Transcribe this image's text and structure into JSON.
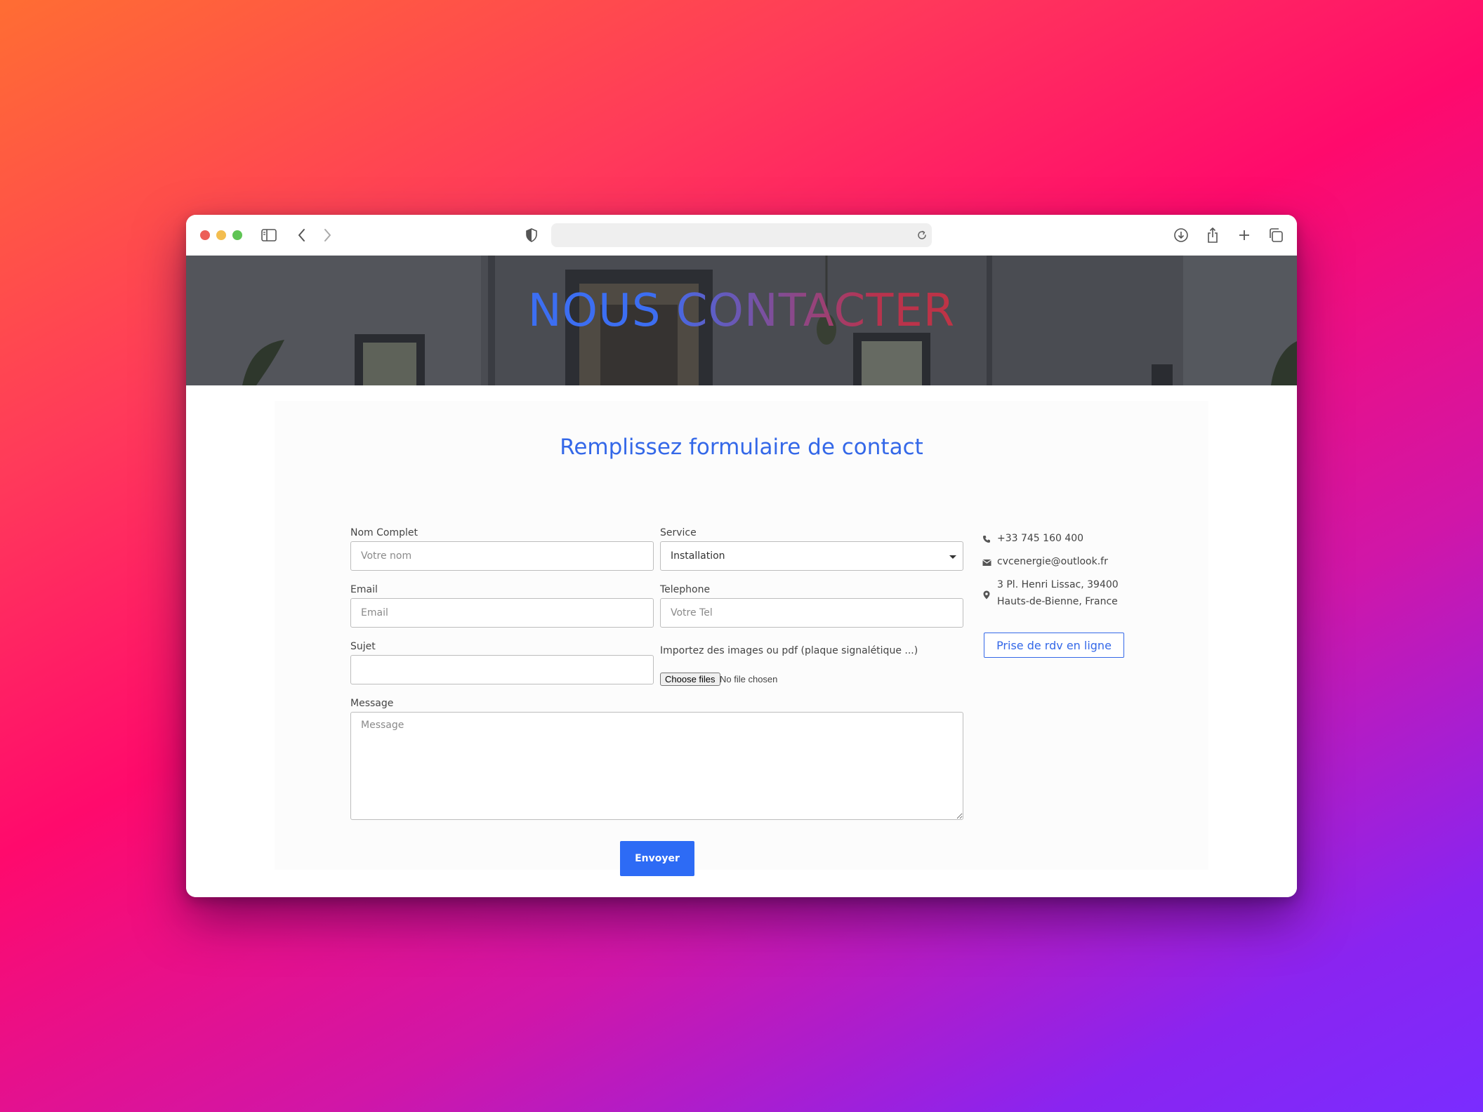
{
  "browser": {
    "url": "",
    "icons": [
      "sidebar-icon",
      "back-icon",
      "forward-icon",
      "shield-icon",
      "reload-icon",
      "download-icon",
      "share-icon",
      "new-tab-icon",
      "tabs-overview-icon"
    ]
  },
  "hero": {
    "title": "NOUS CONTACTER"
  },
  "form": {
    "title": "Remplissez formulaire de contact",
    "name_label": "Nom Complet",
    "name_placeholder": "Votre nom",
    "service_label": "Service",
    "service_value": "Installation",
    "email_label": "Email",
    "email_placeholder": "Email",
    "phone_label": "Telephone",
    "phone_placeholder": "Votre Tel",
    "subject_label": "Sujet",
    "subject_placeholder": "",
    "upload_label": "Importez des images ou pdf (plaque signalétique ...)",
    "upload_button": "Choose files",
    "upload_status": "No file chosen",
    "message_label": "Message",
    "message_placeholder": "Message",
    "submit_label": "Envoyer"
  },
  "contact": {
    "phone": "+33 745 160 400",
    "email": "cvcenergie@outlook.fr",
    "address_line1": "3 Pl. Henri Lissac, 39400",
    "address_line2": "Hauts-de-Bienne, France",
    "appointment_button": "Prise de rdv en ligne"
  },
  "colors": {
    "accent": "#3468e8",
    "submit": "#2d6bf5",
    "title_gradient_start": "#3b6ff0",
    "title_gradient_end": "#d83520"
  }
}
